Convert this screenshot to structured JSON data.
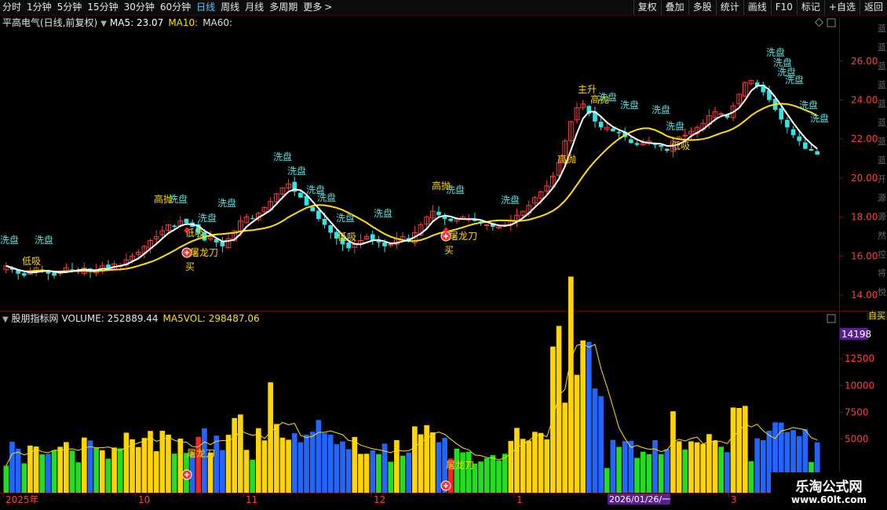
{
  "toolbar": {
    "periods": [
      "分时",
      "1分钟",
      "5分钟",
      "15分钟",
      "30分钟",
      "60分钟",
      "日线",
      "周线",
      "月线",
      "多周期",
      "更多"
    ],
    "active_period": "日线",
    "tools": [
      "复权",
      "叠加",
      "多股",
      "统计",
      "画线",
      "F10",
      "标记",
      "+自选",
      "返回"
    ]
  },
  "title": {
    "stock": "平高电气(日线,前复权)",
    "ma5": "MA5: 23.07",
    "ma10": "MA10:",
    "ma60": "MA60:"
  },
  "volume_header": {
    "name": "股朋指标网",
    "volume": "VOLUME: 252889.44",
    "ma5vol": "MA5VOL: 298487.06"
  },
  "price_axis": [
    "26.00",
    "24.00",
    "22.00",
    "20.00",
    "18.00",
    "16.00",
    "14.00"
  ],
  "volume_axis": [
    "12500",
    "10000",
    "7500",
    "5000"
  ],
  "volume_axis_highlight": "14198",
  "date_axis": [
    "2025年",
    "10",
    "11",
    "12",
    "1",
    "3"
  ],
  "cursor_date": "2026/01/26/一",
  "annotations": {
    "wash": "洗盘",
    "low_buy": "低吸",
    "high_sell": "高抛",
    "main_rise": "主升",
    "dragon_knife": "屠龙刀",
    "buy": "买"
  },
  "watermark": {
    "line1": "乐淘公式网",
    "line2": "www.60lt.com"
  },
  "side_text": "蓝蓝蓝蓝蓝蓝蓝蓝开源源然控将悦",
  "side_volume_text": "自买",
  "colors": {
    "up": "#ff3a3a",
    "down": "#2ee6e6",
    "ma_white": "#ffffff",
    "ma_yellow": "#ffe000",
    "vol_yellow": "#ffd400",
    "vol_green": "#22dd22",
    "vol_blue": "#2266ff",
    "vol_red": "#ff2020",
    "purple": "#5a1f8c",
    "label_cyan": "#4fe0e0",
    "label_yellow": "#ffd700"
  },
  "chart_data": [
    {
      "type": "candlestick",
      "title": "平高电气(日线,前复权)",
      "ylim": [
        13.2,
        27.6
      ],
      "series": [
        {
          "name": "MA5",
          "last": 23.07
        },
        {
          "name": "MA10"
        },
        {
          "name": "MA60"
        }
      ],
      "close": [
        15.5,
        15.3,
        15.1,
        15.0,
        15.2,
        15.4,
        15.3,
        15.1,
        15.0,
        15.2,
        15.4,
        15.3,
        15.2,
        15.4,
        15.2,
        15.3,
        15.5,
        15.4,
        15.6,
        15.5,
        15.8,
        16.0,
        16.2,
        16.5,
        16.8,
        17.0,
        17.3,
        17.6,
        17.5,
        17.8,
        17.7,
        17.5,
        17.2,
        16.8,
        17.0,
        16.7,
        16.5,
        16.9,
        17.3,
        17.8,
        18.0,
        17.9,
        18.2,
        18.5,
        18.8,
        19.2,
        19.5,
        19.7,
        19.3,
        19.0,
        18.6,
        18.3,
        17.9,
        17.6,
        17.2,
        16.9,
        16.6,
        16.4,
        16.6,
        16.8,
        17.0,
        16.8,
        16.7,
        16.5,
        16.6,
        16.9,
        17.0,
        16.8,
        17.2,
        17.6,
        18.0,
        18.3,
        18.1,
        17.9,
        17.8,
        17.9,
        18.0,
        17.9,
        17.8,
        17.7,
        17.6,
        17.5,
        17.5,
        17.6,
        17.8,
        18.1,
        18.3,
        18.6,
        19.0,
        19.3,
        19.6,
        20.1,
        20.8,
        21.9,
        22.9,
        23.6,
        23.8,
        23.3,
        22.9,
        22.6,
        22.6,
        22.4,
        22.3,
        22.1,
        21.8,
        21.7,
        21.8,
        21.9,
        21.7,
        21.6,
        21.4,
        21.9,
        22.1,
        22.2,
        22.4,
        22.6,
        22.8,
        23.2,
        23.4,
        23.3,
        23.1,
        23.7,
        24.3,
        24.9,
        25.0,
        24.7,
        24.4,
        24.0,
        23.5,
        23.0,
        22.6,
        22.2,
        21.9,
        21.5,
        21.4,
        21.2
      ],
      "volume_peak": 14198
    }
  ]
}
